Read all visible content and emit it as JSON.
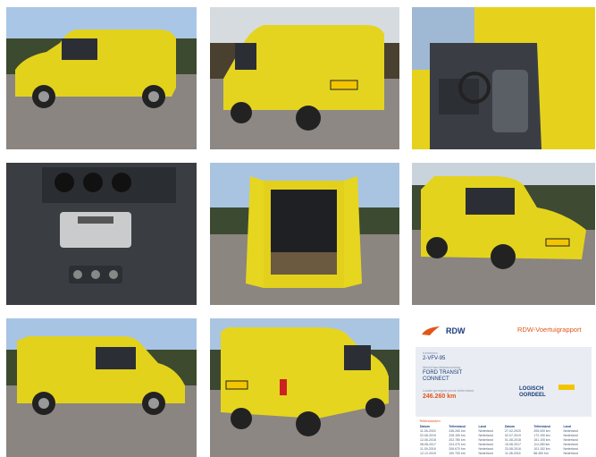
{
  "gallery": {
    "photos": [
      {
        "icon": "van-side-left-photo"
      },
      {
        "icon": "van-front-three-quarter-photo"
      },
      {
        "icon": "van-cabin-interior-photo"
      },
      {
        "icon": "dashboard-radio-photo"
      },
      {
        "icon": "cargo-area-open-doors-photo"
      },
      {
        "icon": "van-front-right-photo"
      },
      {
        "icon": "van-side-right-photo"
      },
      {
        "icon": "van-rear-three-quarter-photo"
      }
    ],
    "plate": "2-VFV-95"
  },
  "report": {
    "brand": "RDW",
    "title": "RDW-Voertuigrapport",
    "kenteken_label": "Kenteken",
    "kenteken": "2-VFV-95",
    "model_label": "Merk/Handelsbenaming",
    "model_line1": "FORD TRANSIT",
    "model_line2": "CONNECT",
    "km_label": "Laatst geregistreerde tellerstand",
    "km_value": "246.260 km",
    "owner_line1": "LOGISCH",
    "owner_line2": "OORDEEL",
    "colors": {
      "accent": "#e2561a",
      "navy": "#1b3d7a",
      "band": "#e9edf3",
      "yellow": "#f2c500"
    },
    "history_title": "Tellerstanden",
    "history_columns": [
      "Datum",
      "Tellerstand",
      "Land",
      "Datum",
      "Tellerstand",
      "Land"
    ],
    "history_rows": [
      [
        "11-05-2020",
        "246.260 km",
        "Nederland",
        "27-02-2020",
        "205.000 km",
        "Nederland"
      ],
      [
        "02-06-2019",
        "228.150 km",
        "Nederland",
        "02-07-2019",
        "172.190 km",
        "Nederland"
      ],
      [
        "12-06-2018",
        "202.780 km",
        "Nederland",
        "01-08-2018",
        "151.105 km",
        "Nederland"
      ],
      [
        "08-08-2017",
        "224.470 km",
        "Nederland",
        "15-08-2017",
        "114.280 km",
        "Nederland"
      ],
      [
        "11-09-2016",
        "206.670 km",
        "Nederland",
        "23-08-2016",
        "101.152 km",
        "Nederland"
      ],
      [
        "12-12-2015",
        "190.700 km",
        "Nederland",
        "11-08-2015",
        "88.450 km",
        "Nederland"
      ]
    ]
  }
}
